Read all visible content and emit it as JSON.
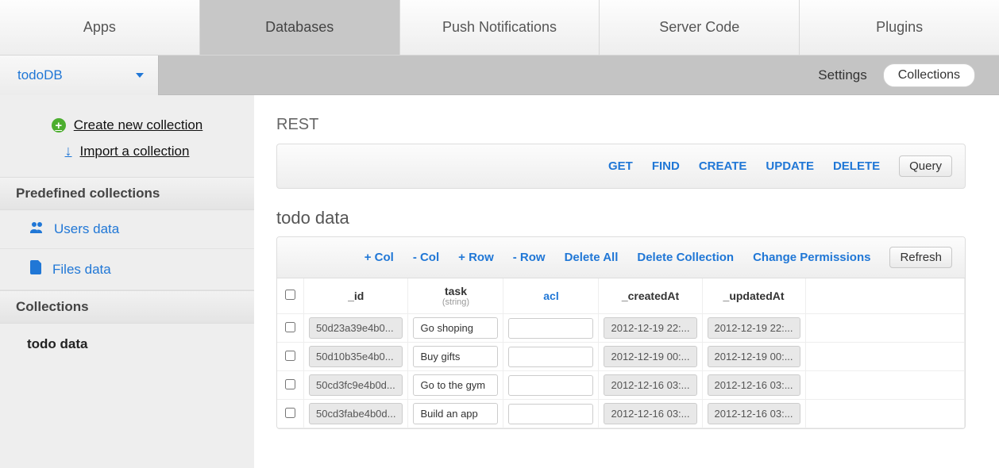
{
  "tabs": [
    "Apps",
    "Databases",
    "Push Notifications",
    "Server Code",
    "Plugins"
  ],
  "active_tab_index": 1,
  "db_selector": {
    "name": "todoDB"
  },
  "subbar": {
    "settings": "Settings",
    "collections": "Collections"
  },
  "sidebar": {
    "create_label": "Create new collection",
    "import_label": "Import a collection",
    "predefined_header": "Predefined collections",
    "predefined": [
      {
        "label": "Users data",
        "icon": "users-icon"
      },
      {
        "label": "Files data",
        "icon": "files-icon"
      }
    ],
    "collections_header": "Collections",
    "collections": [
      {
        "label": "todo data"
      }
    ]
  },
  "rest": {
    "title": "REST",
    "methods": [
      "GET",
      "FIND",
      "CREATE",
      "UPDATE",
      "DELETE"
    ],
    "query_button": "Query"
  },
  "table": {
    "title": "todo data",
    "toolbar": {
      "add_col": "+ Col",
      "del_col": "- Col",
      "add_row": "+ Row",
      "del_row": "- Row",
      "delete_all": "Delete All",
      "delete_collection": "Delete Collection",
      "change_permissions": "Change Permissions",
      "refresh": "Refresh"
    },
    "columns": {
      "id": "_id",
      "task": "task",
      "task_type": "(string)",
      "acl": "acl",
      "created": "_createdAt",
      "updated": "_updatedAt"
    },
    "rows": [
      {
        "id": "50d23a39e4b0...",
        "task": "Go shoping",
        "acl": "",
        "created": "2012-12-19 22:...",
        "updated": "2012-12-19 22:..."
      },
      {
        "id": "50d10b35e4b0...",
        "task": "Buy gifts",
        "acl": "",
        "created": "2012-12-19 00:...",
        "updated": "2012-12-19 00:..."
      },
      {
        "id": "50cd3fc9e4b0d...",
        "task": "Go to the gym",
        "acl": "",
        "created": "2012-12-16 03:...",
        "updated": "2012-12-16 03:..."
      },
      {
        "id": "50cd3fabe4b0d...",
        "task": "Build an app",
        "acl": "",
        "created": "2012-12-16 03:...",
        "updated": "2012-12-16 03:..."
      }
    ]
  }
}
